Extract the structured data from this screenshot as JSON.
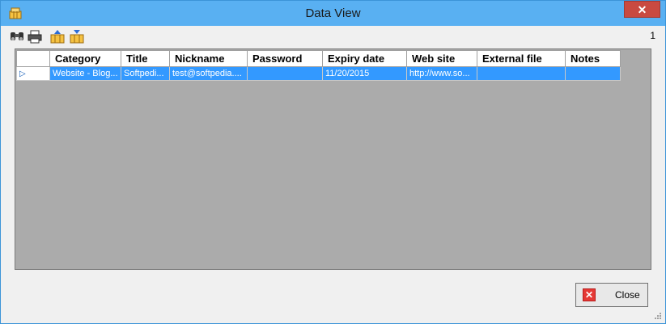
{
  "window": {
    "title": "Data View"
  },
  "titlebar": {
    "close_glyph": "✕"
  },
  "toolbar": {
    "buttons": [
      {
        "icon": "binoculars-icon"
      },
      {
        "icon": "printer-icon"
      },
      {
        "icon": "export-icon"
      },
      {
        "icon": "import-icon"
      }
    ],
    "record_count": "1"
  },
  "grid": {
    "columns": [
      "Category",
      "Title",
      "Nickname",
      "Password",
      "Expiry date",
      "Web site",
      "External file",
      "Notes"
    ],
    "rows": [
      {
        "selector": "▷",
        "cells": [
          "Website - Blog...",
          "Softpedi...",
          "test@softpedia....",
          "",
          "11/20/2015",
          "http://www.so...",
          "",
          ""
        ]
      }
    ]
  },
  "footer": {
    "close_label": "Close",
    "close_icon": "red-x-icon"
  }
}
